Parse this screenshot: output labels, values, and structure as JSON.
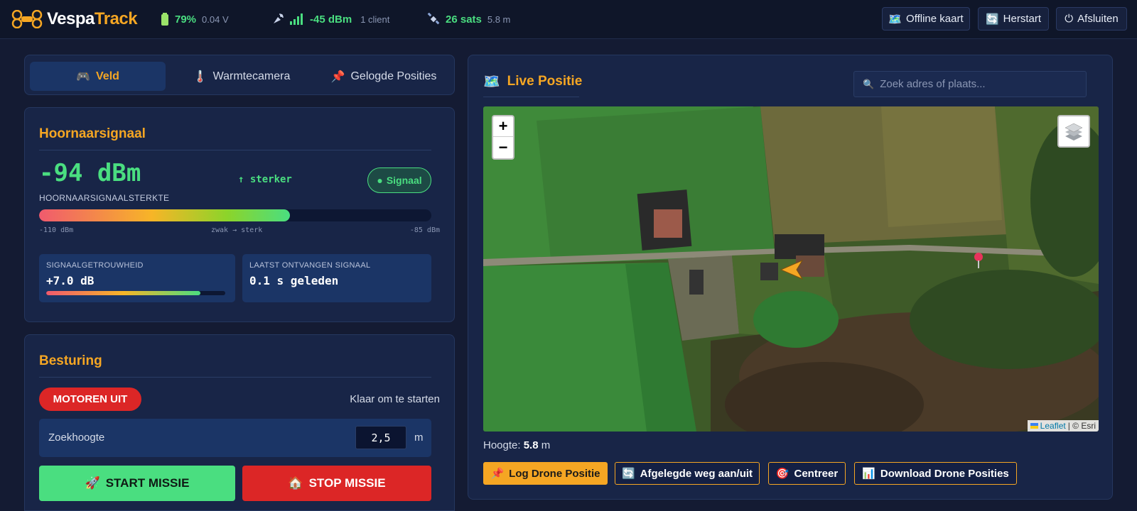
{
  "brand": {
    "name_a": "Vespa",
    "name_b": "Track"
  },
  "status": {
    "battery": {
      "percent": "79%",
      "voltage": "0.04 V"
    },
    "wifi": {
      "rssi": "-45 dBm",
      "clients": "1 client"
    },
    "gps": {
      "sats": "26 sats",
      "accuracy": "5.8 m"
    }
  },
  "top_buttons": {
    "offline_map": "Offline kaart",
    "restart": "Herstart",
    "shutdown": "Afsluiten"
  },
  "tabs": [
    {
      "icon": "🎮",
      "label": "Veld"
    },
    {
      "icon": "🌡️",
      "label": "Warmtecamera"
    },
    {
      "icon": "📌",
      "label": "Gelogde Posities"
    }
  ],
  "signal": {
    "title": "Hoornaarsignaal",
    "value": "-94 dBm",
    "caption": "HOORNAARSIGNAALSTERKTE",
    "trend": "↑ sterker",
    "badge": "Signaal",
    "strength_fraction": 0.64,
    "scale_min": "-110 dBm",
    "scale_mid": "zwak → sterk",
    "scale_max": "-85 dBm",
    "reliability_label": "SIGNAALGETROUWHEID",
    "reliability_value": "+7.0 dB",
    "reliability_fraction": 0.86,
    "last_label": "LAATST ONTVANGEN SIGNAAL",
    "last_value": "0.1 s geleden"
  },
  "control": {
    "title": "Besturing",
    "motor_status": "MOTOREN UIT",
    "ready_text": "Klaar om te starten",
    "altitude_label": "Zoekhoogte",
    "altitude_value": "2,5",
    "altitude_unit": "m",
    "start_label": "START MISSIE",
    "stop_label": "STOP MISSIE"
  },
  "map": {
    "title": "Live Positie",
    "search_placeholder": "Zoek adres of plaats...",
    "zoom_in": "+",
    "zoom_out": "−",
    "attribution_link": "Leaflet",
    "attribution_rest": "| © Esri",
    "altitude_label": "Hoogte:",
    "altitude_value": "5.8",
    "altitude_unit": "m"
  },
  "actions": {
    "log": "Log Drone Positie",
    "trail": "Afgelegde weg aan/uit",
    "center": "Centreer",
    "download": "Download Drone Posities"
  },
  "colors": {
    "accent": "#f5a623",
    "good": "#4ade80",
    "danger": "#dc2626",
    "panel": "#182547",
    "background": "#141b33"
  }
}
